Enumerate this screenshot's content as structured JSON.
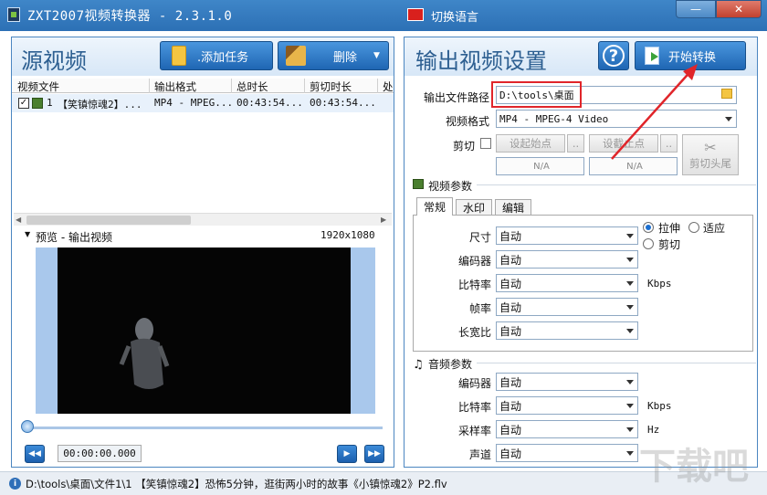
{
  "window": {
    "title": "ZXT2007视频转换器 - 2.3.1.0",
    "language_label": "切换语言",
    "minimize": "—",
    "close": "✕"
  },
  "left": {
    "title": "源视频",
    "add_task_label": ".添加任务",
    "delete_label": "删除",
    "columns": [
      "视频文件",
      "输出格式",
      "总时长",
      "剪切时长",
      "处"
    ],
    "row": {
      "index": "1",
      "name": "【笑镇惊魂2】...",
      "format": "MP4 - MPEG...",
      "duration": "00:43:54...",
      "cut_duration": "00:43:54..."
    },
    "preview_label": "预览 - 输出视频",
    "resolution": "1920x1080",
    "time": "00:00:00.000"
  },
  "right": {
    "title": "输出视频设置",
    "help": "?",
    "start_label": "开始转换",
    "output_path_label": "输出文件路径",
    "output_path_value": "D:\\tools\\桌面",
    "video_format_label": "视频格式",
    "video_format_value": "MP4 - MPEG-4 Video",
    "cut_label": "剪切",
    "set_start_label": "设起始点",
    "set_end_label": "设截止点",
    "dots": "..",
    "start_value": "N/A",
    "end_value": "N/A",
    "cut_head_tail_label": "剪切头尾",
    "video_params_label": "视频参数",
    "tabs": [
      "常规",
      "水印",
      "编辑"
    ],
    "video_fields": [
      {
        "label": "尺寸",
        "value": "自动",
        "unit": ""
      },
      {
        "label": "编码器",
        "value": "自动",
        "unit": ""
      },
      {
        "label": "比特率",
        "value": "自动",
        "unit": "Kbps"
      },
      {
        "label": "帧率",
        "value": "自动",
        "unit": ""
      },
      {
        "label": "长宽比",
        "value": "自动",
        "unit": ""
      }
    ],
    "scale_options": [
      "拉伸",
      "适应",
      "剪切"
    ],
    "audio_params_label": "音频参数",
    "audio_fields": [
      {
        "label": "编码器",
        "value": "自动",
        "unit": ""
      },
      {
        "label": "比特率",
        "value": "自动",
        "unit": "Kbps"
      },
      {
        "label": "采样率",
        "value": "自动",
        "unit": "Hz"
      },
      {
        "label": "声道",
        "value": "自动",
        "unit": ""
      }
    ]
  },
  "status": {
    "text": "D:\\tools\\桌面\\文件1\\1 【笑镇惊魂2】恐怖5分钟，逛街两小时的故事《小镇惊魂2》P2.flv"
  },
  "watermark": "下载吧",
  "colors": {
    "accent": "#2c70b5",
    "highlight_box": "#e0252a",
    "arrow": "#e0252a"
  }
}
